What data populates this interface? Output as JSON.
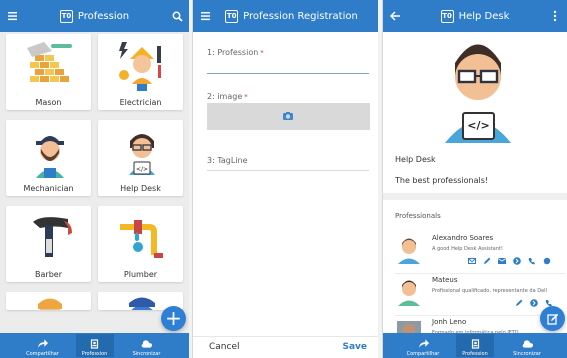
{
  "colors": {
    "primary": "#2f7dc9",
    "primary_dark": "#246aae",
    "save": "#2f7dc9",
    "image_box": "#d9d9d9"
  },
  "screen1": {
    "title": "Profession",
    "tiles": [
      {
        "label": "Mason",
        "icon": "mason-icon"
      },
      {
        "label": "Electrician",
        "icon": "electrician-icon"
      },
      {
        "label": "Mechanician",
        "icon": "mechanician-icon"
      },
      {
        "label": "Help Desk",
        "icon": "help-desk-icon"
      },
      {
        "label": "Barber",
        "icon": "barber-icon"
      },
      {
        "label": "Plumber",
        "icon": "plumber-icon"
      }
    ],
    "nav": [
      {
        "label": "Compartilhar",
        "icon": "share-icon"
      },
      {
        "label": "Profession",
        "icon": "profession-icon"
      },
      {
        "label": "Sincronizar",
        "icon": "cloud-icon"
      }
    ],
    "fab_icon": "plus-icon"
  },
  "screen2": {
    "title": "Profession Registration",
    "fields": {
      "profession": {
        "label": "1: Profession",
        "required": "*"
      },
      "image": {
        "label": "2: image",
        "required": "*"
      },
      "tagline": {
        "label": "3: TagLine"
      }
    },
    "cancel": "Cancel",
    "save": "Save"
  },
  "screen3": {
    "title": "Help Desk",
    "profession_name": "Help Desk",
    "tagline": "The best professionals!",
    "professionals_header": "Professionals",
    "professionals": [
      {
        "name": "Alexandro Soares",
        "description": "A good Help Desk Assistant!"
      },
      {
        "name": "Mateus",
        "description": "Profissional qualificado, representante da Dell"
      },
      {
        "name": "Jonh Leno",
        "description": "Formado em informática pelo IFTO."
      }
    ],
    "nav": [
      {
        "label": "Compartilhar",
        "icon": "share-icon"
      },
      {
        "label": "Profession",
        "icon": "profession-icon"
      },
      {
        "label": "Sincronizar",
        "icon": "cloud-icon"
      }
    ],
    "fab_icon": "edit-icon"
  }
}
